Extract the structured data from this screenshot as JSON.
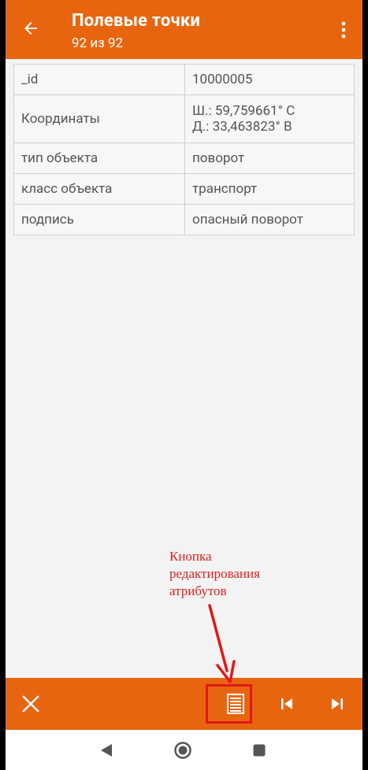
{
  "appbar": {
    "title": "Полевые точки",
    "subtitle": "92 из 92",
    "back_icon": "arrow-left-icon",
    "menu_icon": "more-vert-icon"
  },
  "attributes": [
    {
      "key": "_id",
      "value": "10000005"
    },
    {
      "key": "Координаты",
      "value_lines": [
        "Ш.: 59,759661° С",
        "Д.: 33,463823° В"
      ]
    },
    {
      "key": "тип объекта",
      "value": "поворот"
    },
    {
      "key": "класс объекта",
      "value": "транспорт"
    },
    {
      "key": "подпись",
      "value": "опасный поворот"
    }
  ],
  "annotation": {
    "lines": [
      "Кнопка",
      "редактирования",
      "атрибутов"
    ]
  },
  "toolbar": {
    "close_icon": "close-icon",
    "edit_icon": "edit-attributes-icon",
    "prev_icon": "skip-previous-icon",
    "next_icon": "skip-next-icon"
  },
  "sysnav": {
    "back_icon": "triangle-back-icon",
    "home_icon": "circle-home-icon",
    "recent_icon": "square-recent-icon"
  },
  "colors": {
    "accent": "#e8650f",
    "annotation": "#e02020",
    "content_bg": "#f3f3f3",
    "table_border": "#cfcfcf"
  }
}
